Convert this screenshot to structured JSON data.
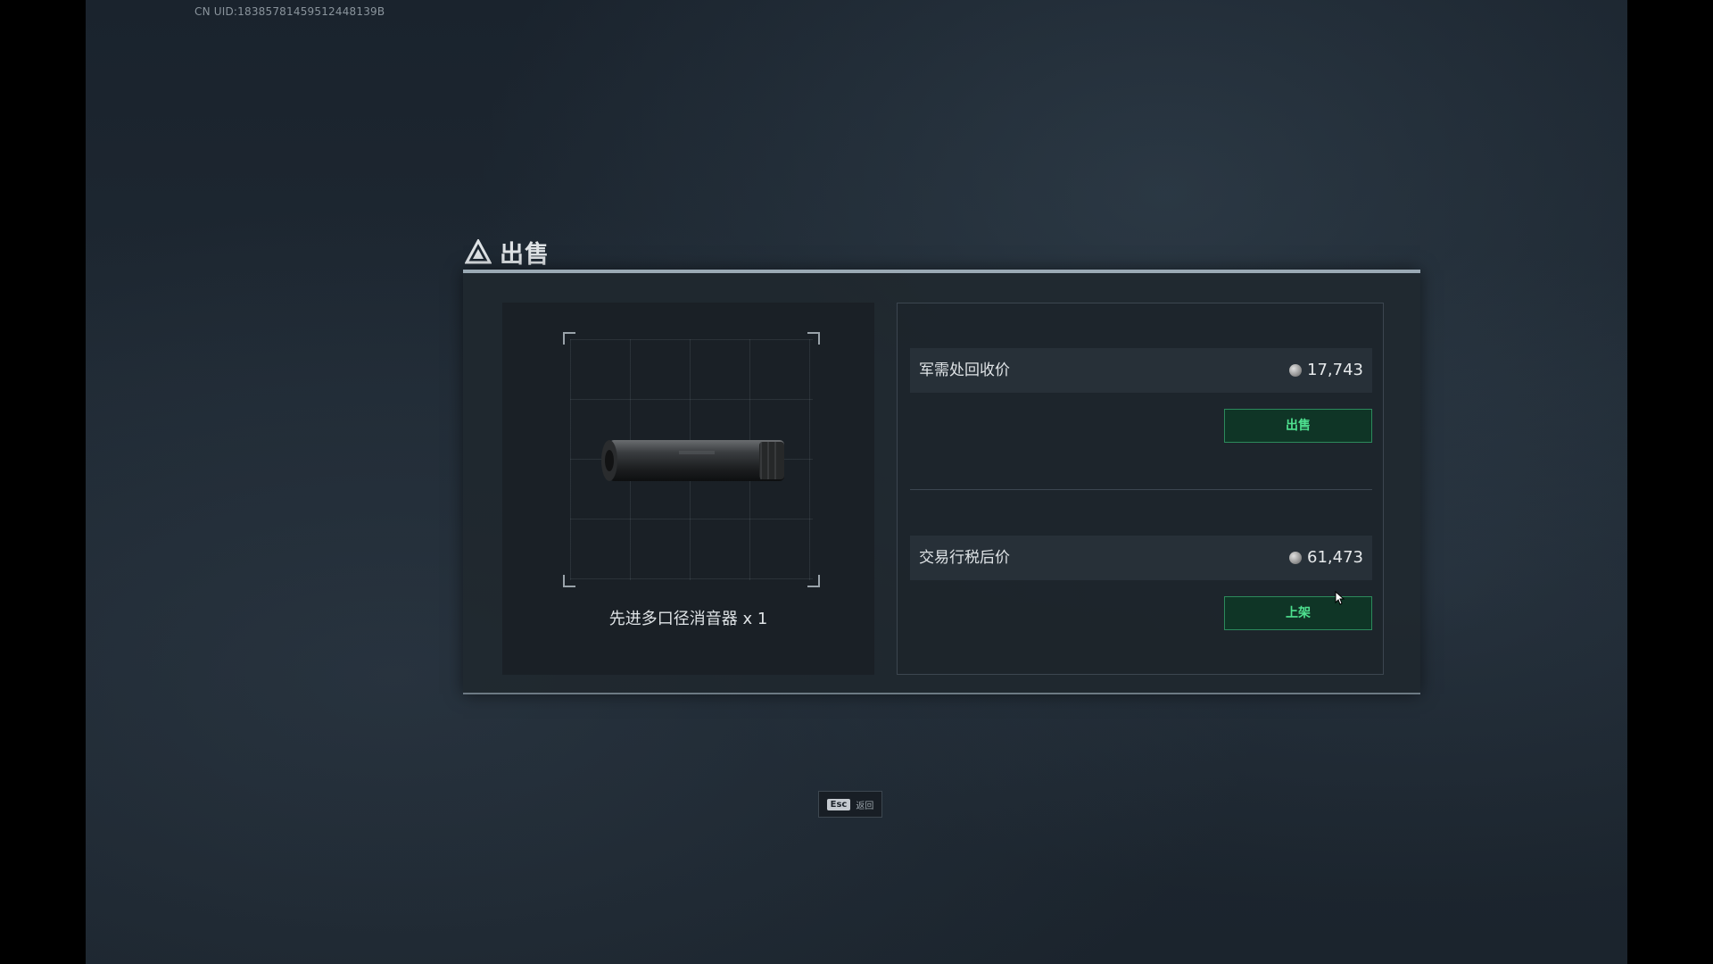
{
  "uid_text": "CN UID:18385781459512448139B",
  "dialog": {
    "title": "出售",
    "title_icon": "warning-triangle-icon"
  },
  "item": {
    "caption": "先进多口径消音器 x 1",
    "image_icon": "suppressor-icon"
  },
  "prices": {
    "recycle": {
      "label": "军需处回收价",
      "value": "17,743",
      "currency_icon": "coin-icon",
      "button_label": "出售"
    },
    "market": {
      "label": "交易行税后价",
      "value": "61,473",
      "currency_icon": "coin-icon",
      "button_label": "上架"
    }
  },
  "footer": {
    "esc_key": "Esc",
    "esc_label": "返回"
  },
  "colors": {
    "accent_green": "#4ee08f",
    "button_bg": "#0f3526",
    "panel_border": "#9aa9b4"
  }
}
